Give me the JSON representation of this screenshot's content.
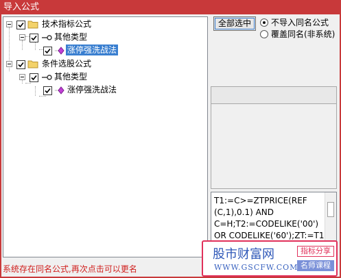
{
  "window": {
    "title": "导入公式"
  },
  "tree": {
    "groups": [
      {
        "label": "技术指标公式",
        "child": {
          "label": "其他类型",
          "leaf": {
            "label": "涨停强洗战法",
            "selected": true
          }
        }
      },
      {
        "label": "条件选股公式",
        "child": {
          "label": "其他类型",
          "leaf": {
            "label": "涨停强洗战法",
            "selected": false
          }
        }
      }
    ]
  },
  "controls": {
    "select_all_label": "全部选中",
    "radio_options": [
      {
        "label": "不导入同名公式",
        "checked": true
      },
      {
        "label": "覆盖同名(非系统)",
        "checked": false
      }
    ]
  },
  "formula": {
    "lines": [
      "T1:=C>=ZTPRICE(REF",
      "(C,1),0.1) AND",
      "C=H;T2:=CODELIKE('00')",
      "OR CODELIKE('60');ZT:=T1"
    ]
  },
  "status": {
    "message": "系统存在同名公式,再次点击可以更名"
  },
  "watermark": {
    "title": "股市财富网",
    "url": "WWW.GSCFW.COM",
    "tag1": "指标分享",
    "tag2": "名师课程"
  },
  "colors": {
    "title_bar": "#c8393a",
    "selection": "#3a7fd0",
    "status_text": "#d0201e"
  }
}
